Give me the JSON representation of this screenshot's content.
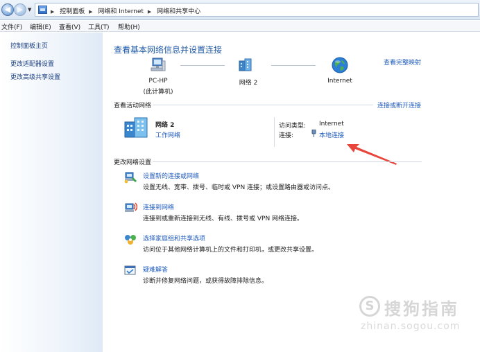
{
  "address_bar": {
    "breadcrumbs": [
      "控制面板",
      "网络和 Internet",
      "网络和共享中心"
    ]
  },
  "menu": [
    "文件(F)",
    "编辑(E)",
    "查看(V)",
    "工具(T)",
    "帮助(H)"
  ],
  "sidebar": {
    "items": [
      {
        "label": "控制面板主页"
      },
      {
        "label": "更改适配器设置"
      },
      {
        "label": "更改高级共享设置"
      }
    ]
  },
  "main": {
    "title": "查看基本网络信息并设置连接",
    "view_full_map": "查看完整映射",
    "map": {
      "computer_name": "PC-HP",
      "computer_sub": "(此计算机)",
      "network_name": "网络  2",
      "internet_label": "Internet"
    },
    "active_networks": {
      "heading": "查看活动网络",
      "connect_disconnect": "连接或断开连接",
      "network_name": "网络  2",
      "network_type": "工作网络",
      "access_type_label": "访问类型:",
      "access_type_value": "Internet",
      "connections_label": "连接:",
      "connections_value": "本地连接"
    },
    "change_settings": {
      "heading": "更改网络设置",
      "tasks": [
        {
          "title": "设置新的连接或网络",
          "desc": "设置无线、宽带、拨号、临时或 VPN 连接；或设置路由器或访问点。",
          "icon": "network-setup-icon"
        },
        {
          "title": "连接到网络",
          "desc": "连接到或重新连接到无线、有线、拨号或 VPN 网络连接。",
          "icon": "connect-network-icon"
        },
        {
          "title": "选择家庭组和共享选项",
          "desc": "访问位于其他网络计算机上的文件和打印机，或更改共享设置。",
          "icon": "homegroup-icon"
        },
        {
          "title": "疑难解答",
          "desc": "诊断并修复网络问题，或获得故障排除信息。",
          "icon": "troubleshoot-icon"
        }
      ]
    }
  },
  "watermark": {
    "text": "搜狗指南",
    "url": "zhinan.sogou.com"
  },
  "colors": {
    "link": "#1f5bbd",
    "title": "#1f5aa6",
    "arrow": "#e8453c"
  }
}
